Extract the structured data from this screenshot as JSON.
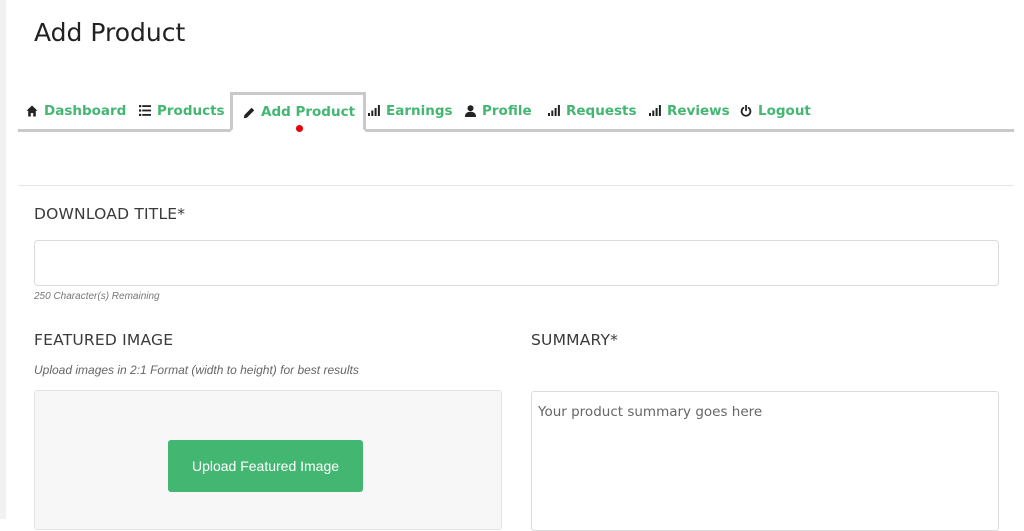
{
  "page": {
    "title": "Add Product"
  },
  "nav": {
    "tabs": [
      {
        "label": "Dashboard",
        "icon": "home-icon"
      },
      {
        "label": "Products",
        "icon": "list-icon"
      },
      {
        "label": "Add Product",
        "icon": "pencil-icon",
        "active": true
      },
      {
        "label": "Earnings",
        "icon": "bar-chart-icon"
      },
      {
        "label": "Profile",
        "icon": "user-icon"
      },
      {
        "label": "Requests",
        "icon": "bar-chart-icon"
      },
      {
        "label": "Reviews",
        "icon": "bar-chart-icon"
      },
      {
        "label": "Logout",
        "icon": "power-icon"
      }
    ]
  },
  "form": {
    "download_title": {
      "label": "DOWNLOAD TITLE*",
      "value": "",
      "remaining": "250 Character(s) Remaining"
    },
    "featured_image": {
      "label": "FEATURED IMAGE",
      "help": "Upload images in 2:1 Format (width to height) for best results",
      "button_label": "Upload Featured Image"
    },
    "summary": {
      "label": "SUMMARY*",
      "placeholder": "Your product summary goes here"
    }
  },
  "colors": {
    "accent": "#43b772",
    "active_dot": "#e8000b",
    "tab_border": "#c9c9c9"
  }
}
